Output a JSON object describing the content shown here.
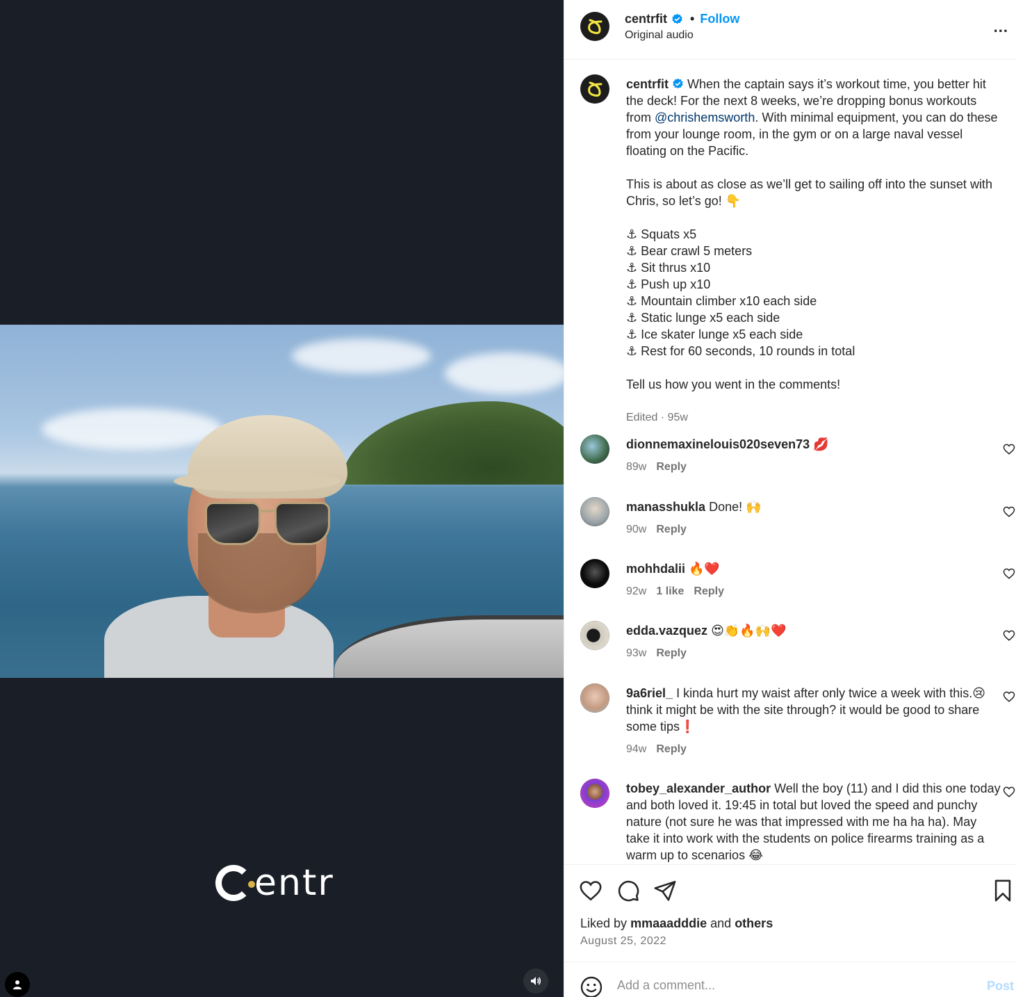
{
  "media": {
    "brand_logo_text": "entr",
    "brand_logo_full": "Centr"
  },
  "header": {
    "username": "centrfit",
    "separator": "•",
    "follow_label": "Follow",
    "subtitle": "Original audio",
    "more_label": "..."
  },
  "caption": {
    "username": "centrfit",
    "intro_before_mention": "When the captain says it’s workout time, you better hit the deck! For the next 8 weeks, we’re dropping bonus workouts from ",
    "mention": "@chrishemsworth",
    "intro_after_mention": ". With minimal equipment, you can do these from your lounge room, in the gym or on a large naval vessel floating on the Pacific.",
    "para2": "This is about as close as we’ll get to sailing off into the sunset with Chris, so let’s go! 👇",
    "list": [
      "⚓ Squats x5",
      "⚓ Bear crawl 5 meters",
      "⚓ Sit thrus x10",
      "⚓ Push up x10",
      "⚓ Mountain climber x10 each side",
      "⚓ Static lunge x5 each side",
      "⚓ Ice skater lunge x5 each side",
      "⚓ Rest for 60 seconds, 10 rounds in total"
    ],
    "closing": "Tell us how you went in the comments!",
    "meta": "Edited · 95w"
  },
  "comments": [
    {
      "username": "dionnemaxinelouis020seven73",
      "text": "💋",
      "age": "89w",
      "likes": "",
      "reply": "Reply",
      "avatar_color": "#3f6a4b"
    },
    {
      "username": "manasshukla",
      "text": "Done! 🙌",
      "age": "90w",
      "likes": "",
      "reply": "Reply",
      "avatar_color": "#9aa3a8"
    },
    {
      "username": "mohhdalii",
      "text": "🔥❤️",
      "age": "92w",
      "likes": "1 like",
      "reply": "Reply",
      "avatar_color": "#0b0b0b"
    },
    {
      "username": "edda.vazquez",
      "text": "😍👏🔥🙌❤️",
      "age": "93w",
      "likes": "",
      "reply": "Reply",
      "avatar_color": "#cfc9bd"
    },
    {
      "username": "9a6riel_",
      "text": "I kinda hurt my waist after only twice a week with this.😢 think it might be with the site through? it would be good to share some tips❗",
      "age": "94w",
      "likes": "",
      "reply": "Reply",
      "avatar_color": "#d8c2b4"
    },
    {
      "username": "tobey_alexander_author",
      "text": "Well the boy (11) and I did this one today and both loved it. 19:45 in total but loved the speed and punchy nature (not sure he was that impressed with me ha ha ha). May take it into work with the students on police firearms training as a warm up to scenarios 😂",
      "age": "",
      "likes": "",
      "reply": "",
      "avatar_color": "#7b3fd1"
    }
  ],
  "actions": {
    "liked_by_prefix": "Liked by",
    "liked_by_user": "mmaaadddie",
    "liked_by_mid": "and",
    "liked_by_others": "others",
    "date": "August 25, 2022"
  },
  "comment_bar": {
    "placeholder": "Add a comment...",
    "post_label": "Post"
  },
  "colors": {
    "accent": "#0095f6",
    "mention": "#00376b",
    "muted": "#737373",
    "brand_yellow": "#f5e642",
    "media_bg": "#1a1e27"
  }
}
